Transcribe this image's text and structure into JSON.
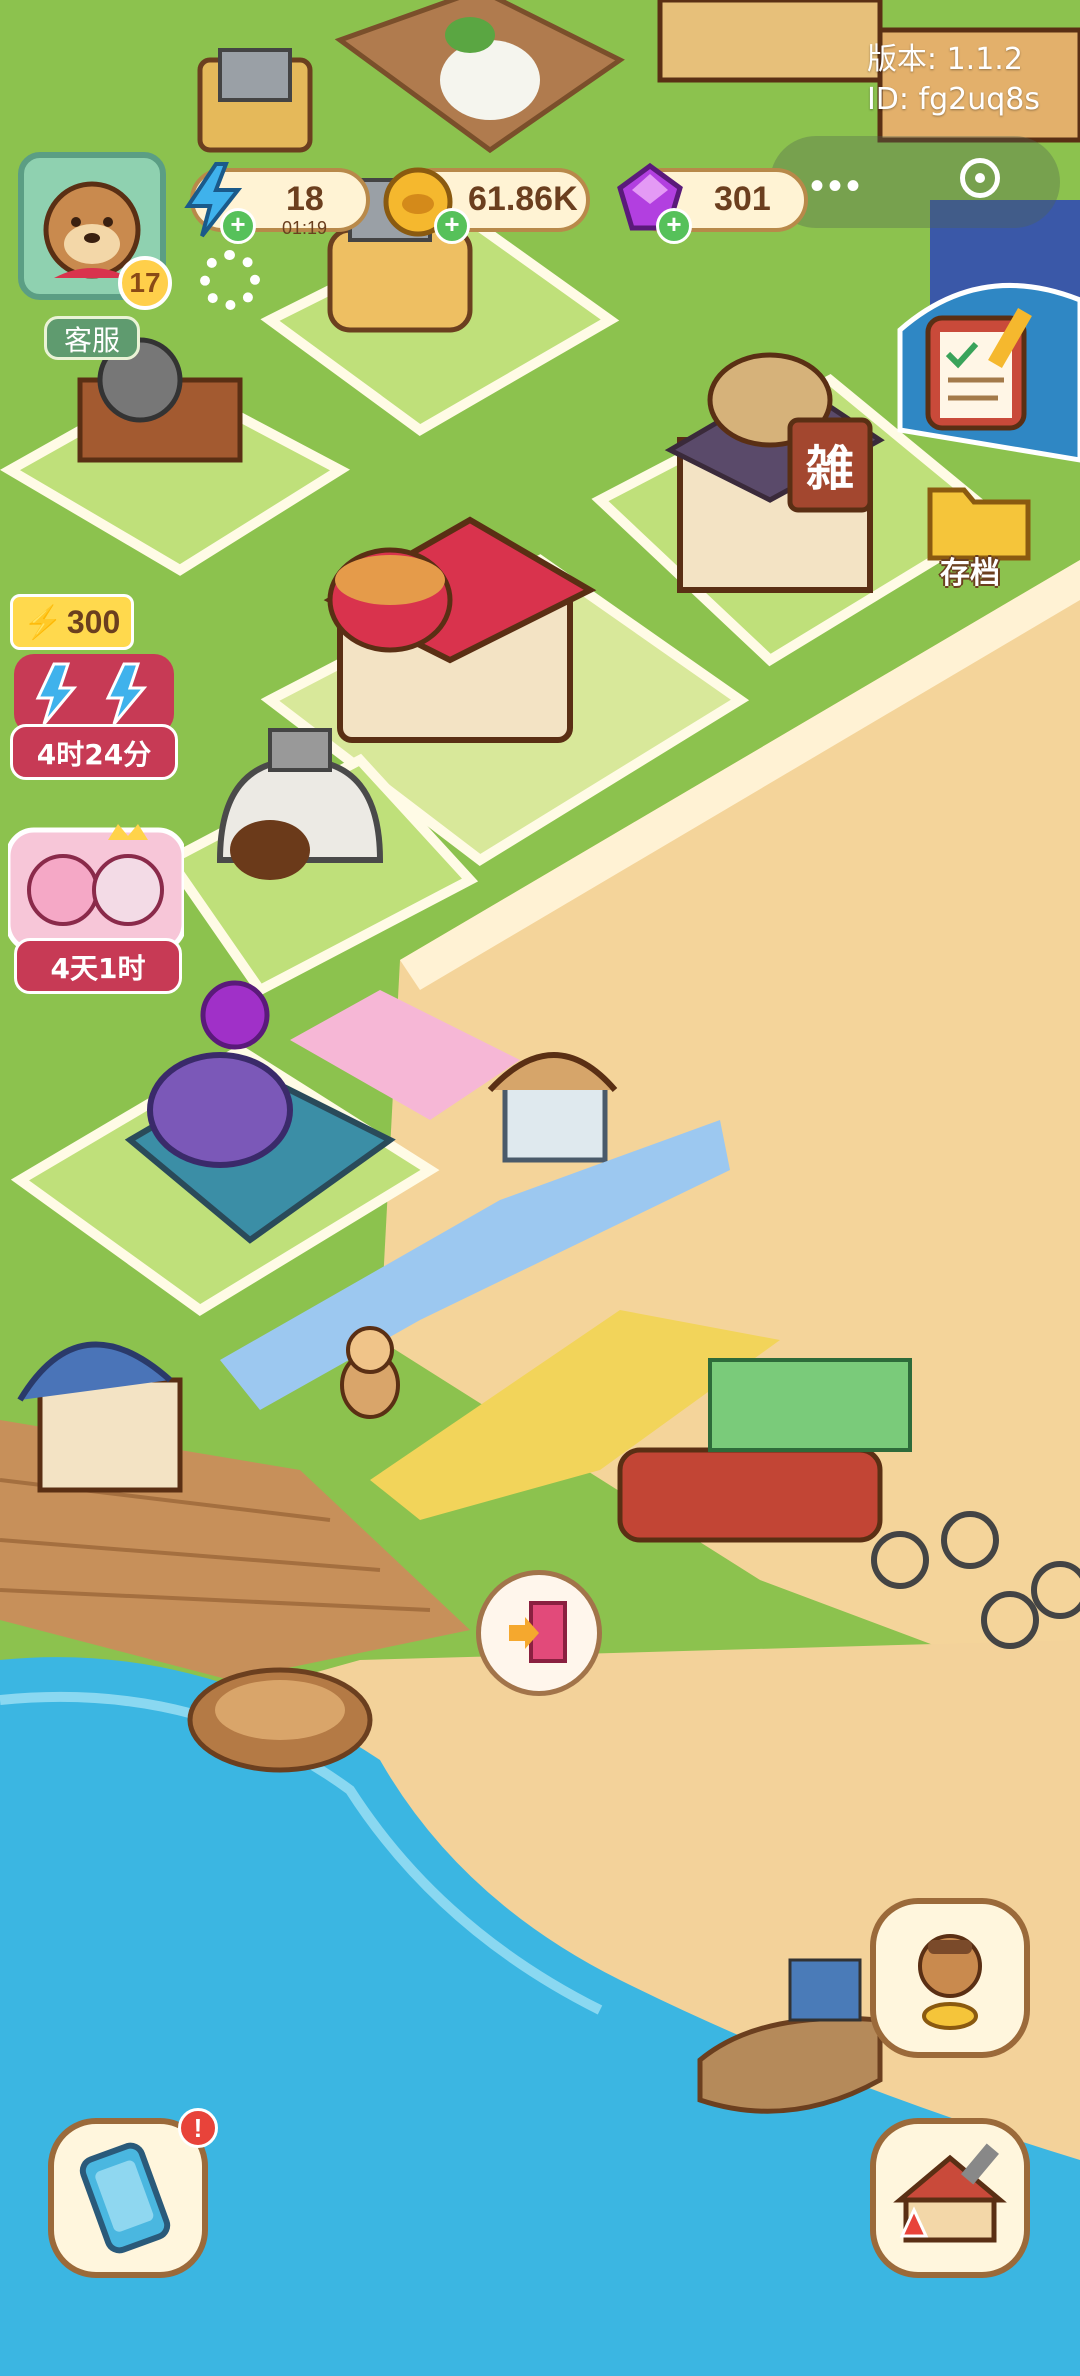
{
  "colors": {
    "grass": "#8cc24e",
    "sand": "#f4d49a",
    "water": "#3bb6e2",
    "accent": "#56c15a",
    "badge": "#c73a55"
  },
  "version": {
    "version_text": "版本: 1.1.2",
    "id_text": "ID: fg2uq8s"
  },
  "player": {
    "level": "17",
    "service_label": "客服"
  },
  "resources": {
    "energy": {
      "value": "18",
      "timer": "01:19",
      "icon": "lightning-icon"
    },
    "coins": {
      "value": "61.86K",
      "icon": "coin-icon"
    },
    "gems": {
      "value": "301",
      "icon": "gem-icon"
    }
  },
  "events": {
    "energy_pack": {
      "amount": "300",
      "countdown": "4时24分"
    },
    "costume_event": {
      "countdown": "4天1时"
    }
  },
  "buttons": {
    "save_label": "存档",
    "phone_badge": "!"
  },
  "signs": {
    "shop_sign": "雑"
  }
}
